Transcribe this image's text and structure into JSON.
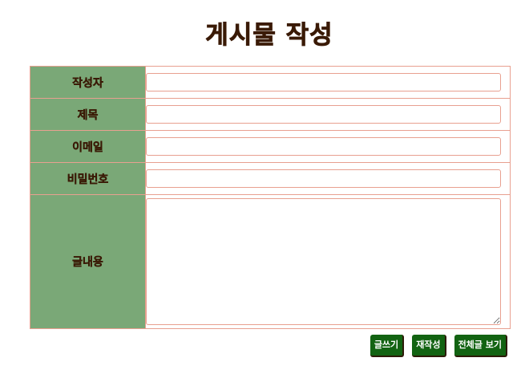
{
  "page": {
    "title": "게시물 작성"
  },
  "form": {
    "fields": [
      {
        "label": "작성자",
        "value": "",
        "placeholder": ""
      },
      {
        "label": "제목",
        "value": "",
        "placeholder": ""
      },
      {
        "label": "이메일",
        "value": "",
        "placeholder": ""
      },
      {
        "label": "비밀번호",
        "value": "",
        "placeholder": ""
      }
    ],
    "content": {
      "label": "글내용",
      "value": "",
      "placeholder": ""
    }
  },
  "buttons": {
    "write": "글쓰기",
    "reset": "재작성",
    "list": "전체글 보기"
  },
  "colors": {
    "title_text": "#3a1a06",
    "label_background": "#7aa877",
    "border": "#e8a090",
    "button_background": "#126312",
    "button_text": "#ffffff"
  }
}
